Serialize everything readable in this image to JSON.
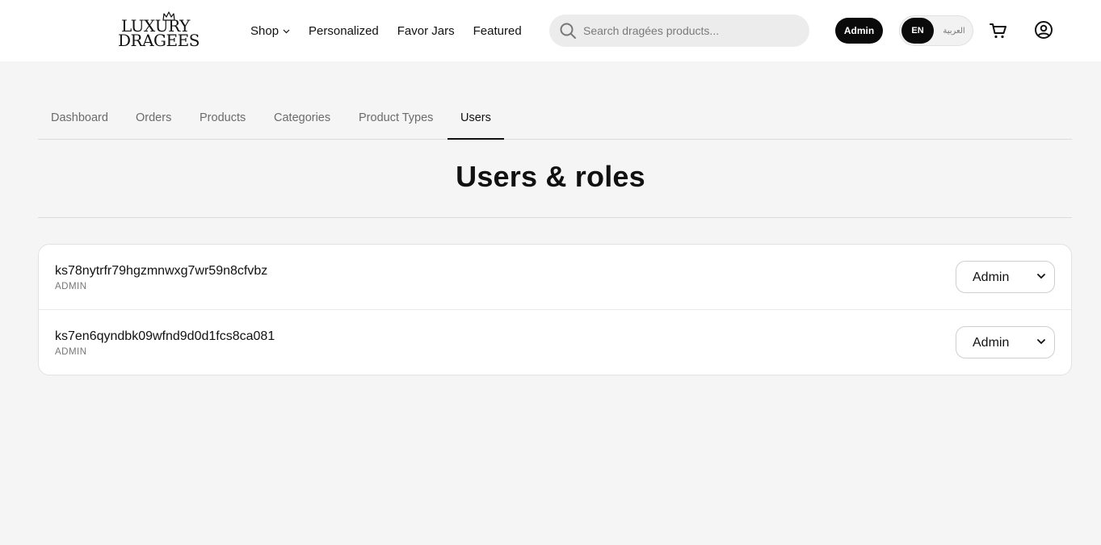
{
  "brand": {
    "logo_line1": "LUXURY",
    "logo_line2": "DRAGEES"
  },
  "nav": {
    "items": [
      {
        "label": "Shop",
        "has_dropdown": true
      },
      {
        "label": "Personalized"
      },
      {
        "label": "Favor Jars"
      },
      {
        "label": "Featured"
      }
    ]
  },
  "search": {
    "placeholder": "Search dragées products...",
    "value": ""
  },
  "header": {
    "admin_label": "Admin",
    "lang_en": "EN",
    "lang_ar": "العربية"
  },
  "tabs": [
    {
      "label": "Dashboard"
    },
    {
      "label": "Orders"
    },
    {
      "label": "Products"
    },
    {
      "label": "Categories"
    },
    {
      "label": "Product Types"
    },
    {
      "label": "Users",
      "active": true
    }
  ],
  "page": {
    "title": "Users & roles"
  },
  "users": [
    {
      "id": "ks78nytrfr79hgzmnwxg7wr59n8cfvbz",
      "role": "ADMIN",
      "selected_role": "Admin"
    },
    {
      "id": "ks7en6qyndbk09wfnd9d0d1fcs8ca081",
      "role": "ADMIN",
      "selected_role": "Admin"
    }
  ],
  "colors": {
    "background": "#f5f5f5",
    "surface": "#ffffff",
    "primary": "#0a0a0a",
    "muted_text": "#6b6b6b"
  }
}
